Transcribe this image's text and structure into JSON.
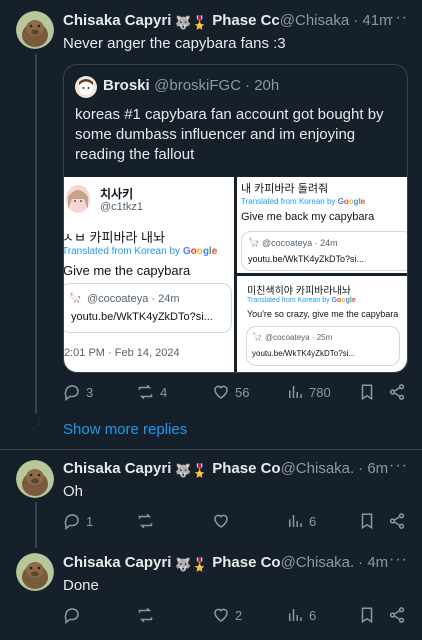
{
  "reply1": {
    "name": "Chisaka Capyri",
    "badge_emoji": "🐺🎖️",
    "extra_name": "Phase Cc",
    "handle": "@Chisaka",
    "time": "· 41m",
    "text": "Never anger the capybara fans :3"
  },
  "quote": {
    "name": "Broski",
    "handle": "@broskiFGC",
    "time": "· 20h",
    "text": "koreas #1 capybara fan account got bought by some dumbass influencer and im enjoying reading the fallout"
  },
  "img1": {
    "name": "치사키",
    "handle": "@c1tkz1",
    "korean": "ㅅㅂ 카피바라 내놔",
    "translated_label": "Translated from Korean by",
    "google": [
      "G",
      "o",
      "o",
      "g",
      "l",
      "e"
    ],
    "english": "Give me the capybara",
    "card_handle": "@cocoateya · 24m",
    "card_link": "youtu.be/WkTK4yZkDTo?si...",
    "timestamp": "2:01 PM · Feb 14, 2024"
  },
  "img2": {
    "korean": "내 카피바라 돌려줘",
    "translated_label": "Translated from Korean by",
    "english": "Give me back my capybara",
    "card_handle": "@cocoateya · 24m",
    "card_link": "youtu.be/WkTK4yZkDTo?si..."
  },
  "img3": {
    "korean": "미친색히야 카피바라내놔",
    "translated_label": "Translated from Korean by",
    "english": "You're so crazy, give me the capybara",
    "card_handle": "@cocoateya · 25m",
    "card_link": "youtu.be/WkTK4yZkDTo?si..."
  },
  "reply1_actions": {
    "replies": "3",
    "reposts": "4",
    "likes": "56",
    "views": "780"
  },
  "show_more": "Show more replies",
  "reply2": {
    "name": "Chisaka Capyri",
    "extra_name": "Phase Co",
    "handle": "@Chisaka.",
    "time": "· 6m",
    "text": "Oh"
  },
  "reply2_actions": {
    "replies": "1",
    "reposts": "",
    "likes": "",
    "views": "6"
  },
  "reply3": {
    "name": "Chisaka Capyri",
    "extra_name": "Phase Co",
    "handle": "@Chisaka.",
    "time": "· 4m",
    "text": "Done"
  },
  "reply3_actions": {
    "replies": "",
    "reposts": "",
    "likes": "2",
    "views": "6"
  },
  "colors": {
    "bg": "#15202b",
    "muted": "#8b98a5",
    "link": "#1d9bf0",
    "border": "#38444d"
  }
}
